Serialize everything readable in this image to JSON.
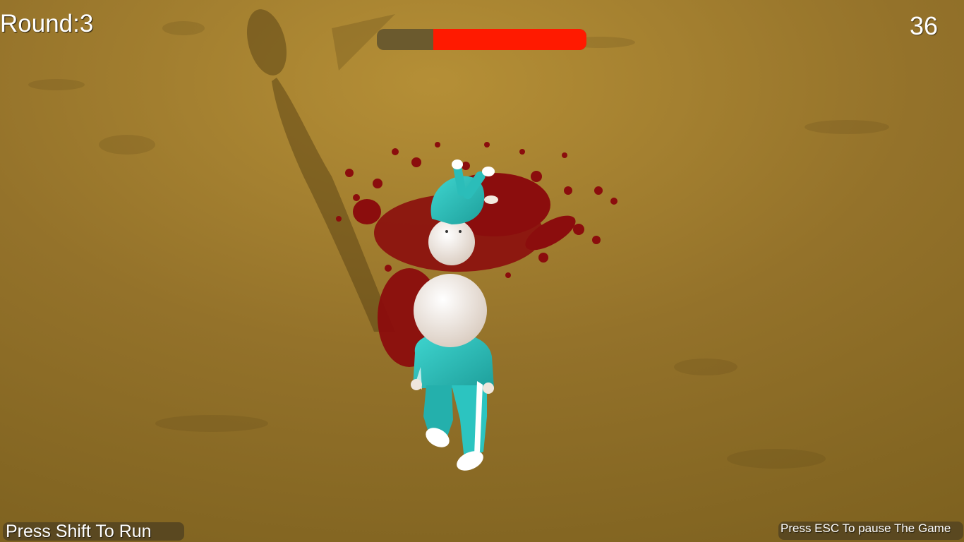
{
  "hud": {
    "round_label": "Round:3",
    "timer_value": "36",
    "health": {
      "fraction": 0.73,
      "fill_color": "#ff1a00",
      "track_color": "#6b5a2e"
    }
  },
  "hints": {
    "run": "Press Shift To Run",
    "pause": "Press ESC To pause The Game",
    "background_color": "#5a4820"
  },
  "scene": {
    "ground_color": "#8a6a1f",
    "blood_color": "#8b0d0d",
    "tracksuit_color": "#2cc4c0",
    "skin_color": "#f0e6dc"
  }
}
